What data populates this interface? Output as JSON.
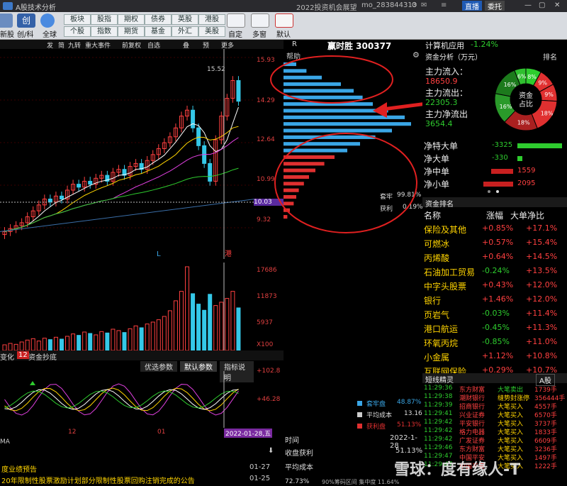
{
  "titlebar": {
    "app_title": "A股技术分析",
    "news": "2022投资机会展望",
    "user": "mo_283844313",
    "btn_live": "直播",
    "btn_entrust": "委托"
  },
  "toolbar": {
    "left_labels": [
      "新股",
      "创/科",
      "全球"
    ],
    "grid": [
      [
        "板块",
        "股指",
        "期权",
        "债券",
        "英股",
        "港股"
      ],
      [
        "个股",
        "指数",
        "期货",
        "基金",
        "外汇",
        "美股"
      ]
    ],
    "right_labels": [
      "自定",
      "多窗",
      "默认"
    ]
  },
  "chart_header": [
    "发",
    "简",
    "九转",
    "重大事件",
    "前复权",
    "自选",
    "叠",
    "预",
    "更多"
  ],
  "price_axis": [
    "15.93",
    "15.52",
    "14.29",
    "12.64",
    "10.99",
    "10.03",
    "9.32"
  ],
  "volume_axis": [
    "17686",
    "11873",
    "5937",
    "X100"
  ],
  "indicator_axis": [
    "+102.8",
    "+46.28"
  ],
  "indicator_tabs": [
    "变化",
    "12",
    "资金抄底"
  ],
  "indicator_buttons": [
    "优选参数",
    "默认参数",
    "指标说明"
  ],
  "time_axis": {
    "ticks": [
      "12",
      "01"
    ],
    "current": "2022-01-28,五",
    "bottom_left": "MA"
  },
  "mid": {
    "header_r": "R",
    "title": "赢时胜 300377",
    "help": "帮助",
    "stats": [
      {
        "k": "套牢",
        "v": "99.81%"
      },
      {
        "k": "获利",
        "v": "0.19%"
      }
    ],
    "legend": [
      {
        "k": "套牢盘",
        "v": "48.87%",
        "c": "#3aa6e6"
      },
      {
        "k": "平均成本",
        "v": "13.16",
        "c": "#ccc"
      },
      {
        "k": "获利盘",
        "v": "51.13%",
        "c": "#e03030"
      }
    ],
    "bottom": {
      "time_label": "时间",
      "time_val": "2022-1-28",
      "profit_label": "收盘获利",
      "profit_val": "51.13%",
      "cost_label": "平均成本",
      "pct": "72.73%",
      "extra": "90%筹码区间 集中度 11.64%"
    }
  },
  "right": {
    "sector": "计算机应用",
    "sector_pct": "-1.24%",
    "fund_title": "资金分析（万元）",
    "rank_btn": "排名",
    "inflow_label": "主力流入：",
    "inflow_val": "18650.9",
    "outflow_label": "主力流出：",
    "outflow_val": "22305.3",
    "net_label": "主力净流出",
    "net_val": "3654.4",
    "donut_center": [
      "资金",
      "占比"
    ],
    "donut_pcts": [
      "8%",
      "9%",
      "9%",
      "18%",
      "18%",
      "16%",
      "16%",
      "6%"
    ],
    "flows": [
      {
        "k": "净特大单",
        "v": "-3325",
        "frac": 0.9
      },
      {
        "k": "净大单",
        "v": "-330",
        "frac": 0.1
      },
      {
        "k": "净中单",
        "v": "1559",
        "frac": 0.45
      },
      {
        "k": "净小单",
        "v": "2095",
        "frac": 0.6
      }
    ],
    "rank_title": "资金排名",
    "rank_headers": [
      "名称",
      "涨幅",
      "大单净比"
    ],
    "rank_rows": [
      {
        "n": "保险及其他",
        "p": "+0.85%",
        "b": "+17.1%"
      },
      {
        "n": "可燃冰",
        "p": "+0.57%",
        "b": "+15.4%"
      },
      {
        "n": "丙烯酸",
        "p": "+0.64%",
        "b": "+14.5%"
      },
      {
        "n": "石油加工贸易",
        "p": "-0.24%",
        "b": "+13.5%"
      },
      {
        "n": "中字头股票",
        "p": "+0.43%",
        "b": "+12.0%"
      },
      {
        "n": "银行",
        "p": "+1.46%",
        "b": "+12.0%"
      },
      {
        "n": "页岩气",
        "p": "-0.03%",
        "b": "+11.4%"
      },
      {
        "n": "港口航运",
        "p": "-0.45%",
        "b": "+11.3%"
      },
      {
        "n": "环氧丙烷",
        "p": "-0.85%",
        "b": "+11.0%"
      },
      {
        "n": "小金属",
        "p": "+1.12%",
        "b": "+10.8%"
      },
      {
        "n": "互联网保险",
        "p": "+0.29%",
        "b": "+10.7%"
      }
    ],
    "trades_title": "短线精灵",
    "trades_filter": "A股",
    "trades": [
      {
        "t": "11:29:36",
        "n": "东方财富",
        "a": "大笔卖出",
        "v": "1739手"
      },
      {
        "t": "11:29:38",
        "n": "潮财银行",
        "a": "缝势封涨停",
        "v": "356444手"
      },
      {
        "t": "11:29:39",
        "n": "招商银行",
        "a": "大笔买入",
        "v": "4557手"
      },
      {
        "t": "11:29:41",
        "n": "兴业证券",
        "a": "大笔买入",
        "v": "6570手"
      },
      {
        "t": "11:29:42",
        "n": "平安银行",
        "a": "大笔买入",
        "v": "3737手"
      },
      {
        "t": "11:29:42",
        "n": "格力电器",
        "a": "大笔买入",
        "v": "1833手"
      },
      {
        "t": "11:29:42",
        "n": "广发证券",
        "a": "大笔买入",
        "v": "6609手"
      },
      {
        "t": "11:29:46",
        "n": "东方财富",
        "a": "大笔买入",
        "v": "3236手"
      },
      {
        "t": "11:29:47",
        "n": "中国平安",
        "a": "大笔买入",
        "v": "1497手"
      },
      {
        "t": "11:29:47",
        "n": "中国平安",
        "a": "大笔买入",
        "v": "1222手"
      }
    ]
  },
  "news": [
    {
      "title": "度业绩预告",
      "date": "01-27"
    },
    {
      "title": "20年限制性股票激励计划部分限制性股票回购注销完成的公告",
      "date": "01-25"
    }
  ],
  "watermark": "雪球：度有缘人-T",
  "colors": {
    "up": "#ff4040",
    "down": "#2ecc2e",
    "accent": "#ffd400",
    "chip_blue": "#3aa6e6"
  },
  "chart_data": {
    "type": "candlestick",
    "price_ylim": [
      9.32,
      15.93
    ],
    "price_labels": [
      15.93,
      14.29,
      12.64,
      10.99,
      9.32
    ],
    "high_mark": 15.52,
    "current_price": 10.03,
    "volume_ylim": [
      0,
      17686
    ],
    "volume_labels": [
      17686,
      11873,
      5937
    ],
    "x_ticks": [
      "12",
      "01"
    ],
    "cursor_date": "2022-01-28,五",
    "closes": [
      10.1,
      10.2,
      10.3,
      10.4,
      10.6,
      10.8,
      11.0,
      11.2,
      11.1,
      11.3,
      11.2,
      11.5,
      11.7,
      11.6,
      11.8,
      11.7,
      11.9,
      12.0,
      11.8,
      12.1,
      12.2,
      12.0,
      12.3,
      12.4,
      12.2,
      12.5,
      12.7,
      12.9,
      13.1,
      13.3,
      13.6,
      14.0,
      14.2,
      13.6,
      13.0,
      12.4,
      11.8,
      13.2,
      14.0,
      14.6,
      15.2,
      14.5
    ],
    "volumes": [
      1200,
      1500,
      1300,
      1800,
      2200,
      2500,
      2000,
      2600,
      2300,
      2800,
      2400,
      3000,
      3500,
      3200,
      3900,
      3600,
      3300,
      4000,
      3700,
      4500,
      4200,
      3800,
      4600,
      5200,
      4800,
      5600,
      6000,
      6500,
      7200,
      8400,
      10500,
      12500,
      17686,
      12000,
      9800,
      8500,
      11873,
      9500,
      10200,
      11000,
      12500,
      9000
    ],
    "chips": [
      0.1,
      0.18,
      0.3,
      0.45,
      0.55,
      0.62,
      0.7,
      0.82,
      0.95,
      1.0,
      0.85,
      0.72,
      0.6,
      0.5,
      0.4,
      0.32,
      0.25,
      0.2,
      0.16,
      0.12,
      0.1,
      0.08,
      0.05,
      0.03
    ]
  }
}
